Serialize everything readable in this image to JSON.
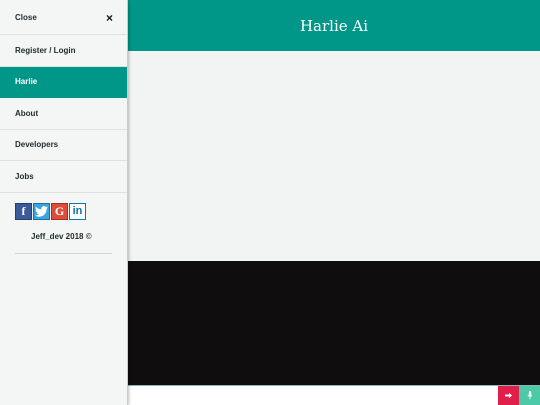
{
  "app": {
    "title": "Harlie Ai"
  },
  "drawer": {
    "close_label": "Close",
    "close_glyph": "×",
    "items": [
      {
        "label": "Register / Login"
      },
      {
        "label": "Harlie"
      },
      {
        "label": "About"
      },
      {
        "label": "Developers"
      },
      {
        "label": "Jobs"
      }
    ],
    "active_item": "Harlie",
    "social": [
      {
        "icon": "facebook-icon",
        "glyph": "f"
      },
      {
        "icon": "twitter-icon",
        "glyph": ""
      },
      {
        "icon": "google-icon",
        "glyph": "G"
      },
      {
        "icon": "linkedin-icon",
        "glyph": "in"
      }
    ],
    "copyright": "Jeff_dev 2018 ©"
  },
  "input": {
    "placeholder": "",
    "value": ""
  },
  "colors": {
    "brand": "#009688",
    "send": "#e0204a",
    "mic": "#4cc9a7",
    "video_bg": "#0f0d0d"
  },
  "icons": {
    "send": "sign-in-icon",
    "mic": "microphone-icon"
  }
}
